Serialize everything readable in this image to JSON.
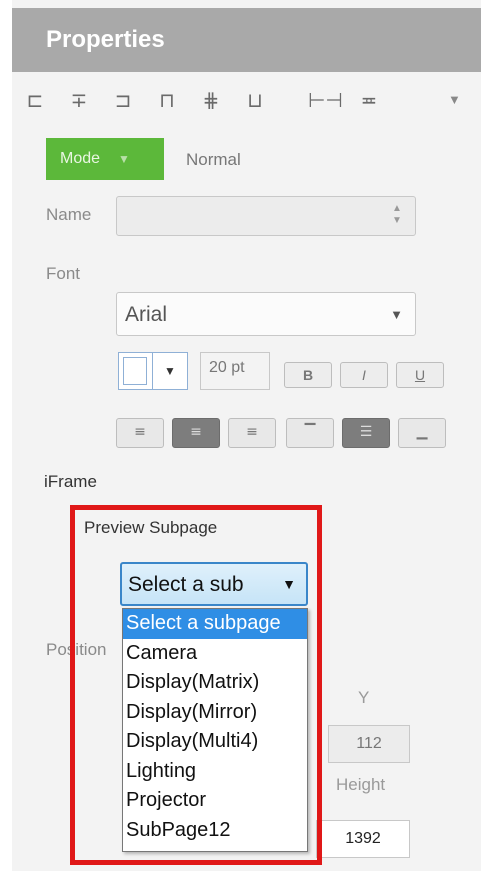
{
  "title": "Properties",
  "toolbar": {
    "icons": [
      "align-left-icon",
      "align-center-icon",
      "align-right-icon",
      "align-top-icon",
      "align-middle-icon",
      "align-bottom-icon",
      "distribute-horizontal-icon",
      "distribute-vertical-icon"
    ],
    "overflow_icon": "chevron-down-icon"
  },
  "mode": {
    "button_label": "Mode",
    "value": "Normal"
  },
  "name": {
    "label": "Name",
    "value": ""
  },
  "font": {
    "label": "Font",
    "family": "Arial",
    "size": "20 pt",
    "color": "#ffffff",
    "bold_label": "B",
    "italic_label": "I",
    "underline_label": "U",
    "alignments": [
      "align-left",
      "align-center",
      "align-right",
      "align-top",
      "align-middle",
      "align-bottom"
    ],
    "active_alignments": [
      "align-center",
      "align-middle"
    ]
  },
  "iframe": {
    "section_label": "iFrame",
    "preview_label": "Preview Subpage",
    "selected_display": "Select a sub",
    "options": [
      "Select a subpage",
      "Camera",
      "Display(Matrix)",
      "Display(Mirror)",
      "Display(Multi4)",
      "Lighting",
      "Projector",
      "SubPage12"
    ],
    "highlighted_index": 0,
    "highlight_color": "#e01818"
  },
  "position": {
    "label": "Position",
    "y_label": "Y",
    "y_value": "112",
    "height_label": "Height",
    "height_value": "1392"
  }
}
